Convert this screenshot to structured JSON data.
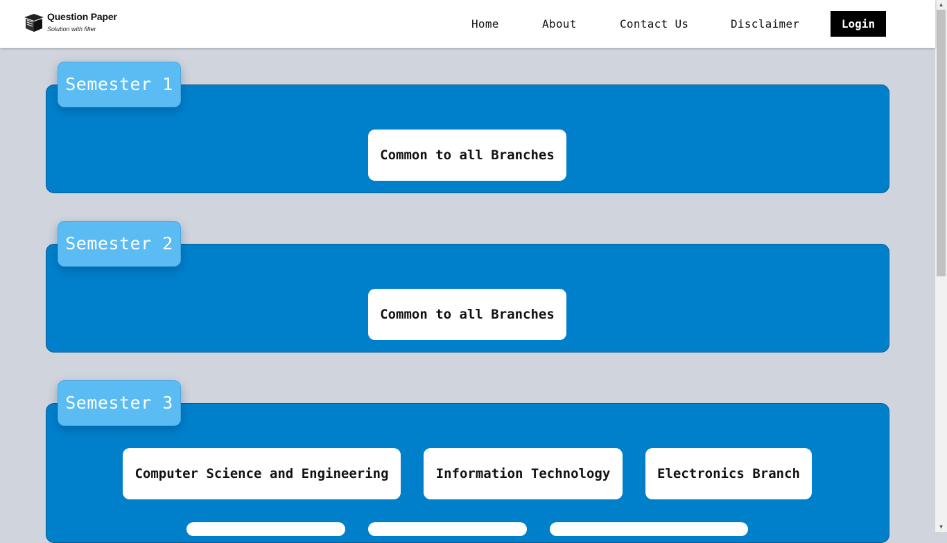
{
  "header": {
    "logo_title": "Question Paper",
    "logo_subtitle": "Solution with filter",
    "nav": [
      "Home",
      "About",
      "Contact Us",
      "Disclaimer"
    ],
    "login_label": "Login"
  },
  "colors": {
    "page_bg": "#d0d4dc",
    "panel_blue": "#0080cb",
    "tab_blue": "#5bbcf4",
    "login_bg": "#000000"
  },
  "semesters": [
    {
      "title": "Semester 1",
      "branches": [
        "Common to all Branches"
      ]
    },
    {
      "title": "Semester 2",
      "branches": [
        "Common to all Branches"
      ]
    },
    {
      "title": "Semester 3",
      "branches": [
        "Computer Science and Engineering",
        "Information Technology",
        "Electronics Branch"
      ]
    }
  ]
}
